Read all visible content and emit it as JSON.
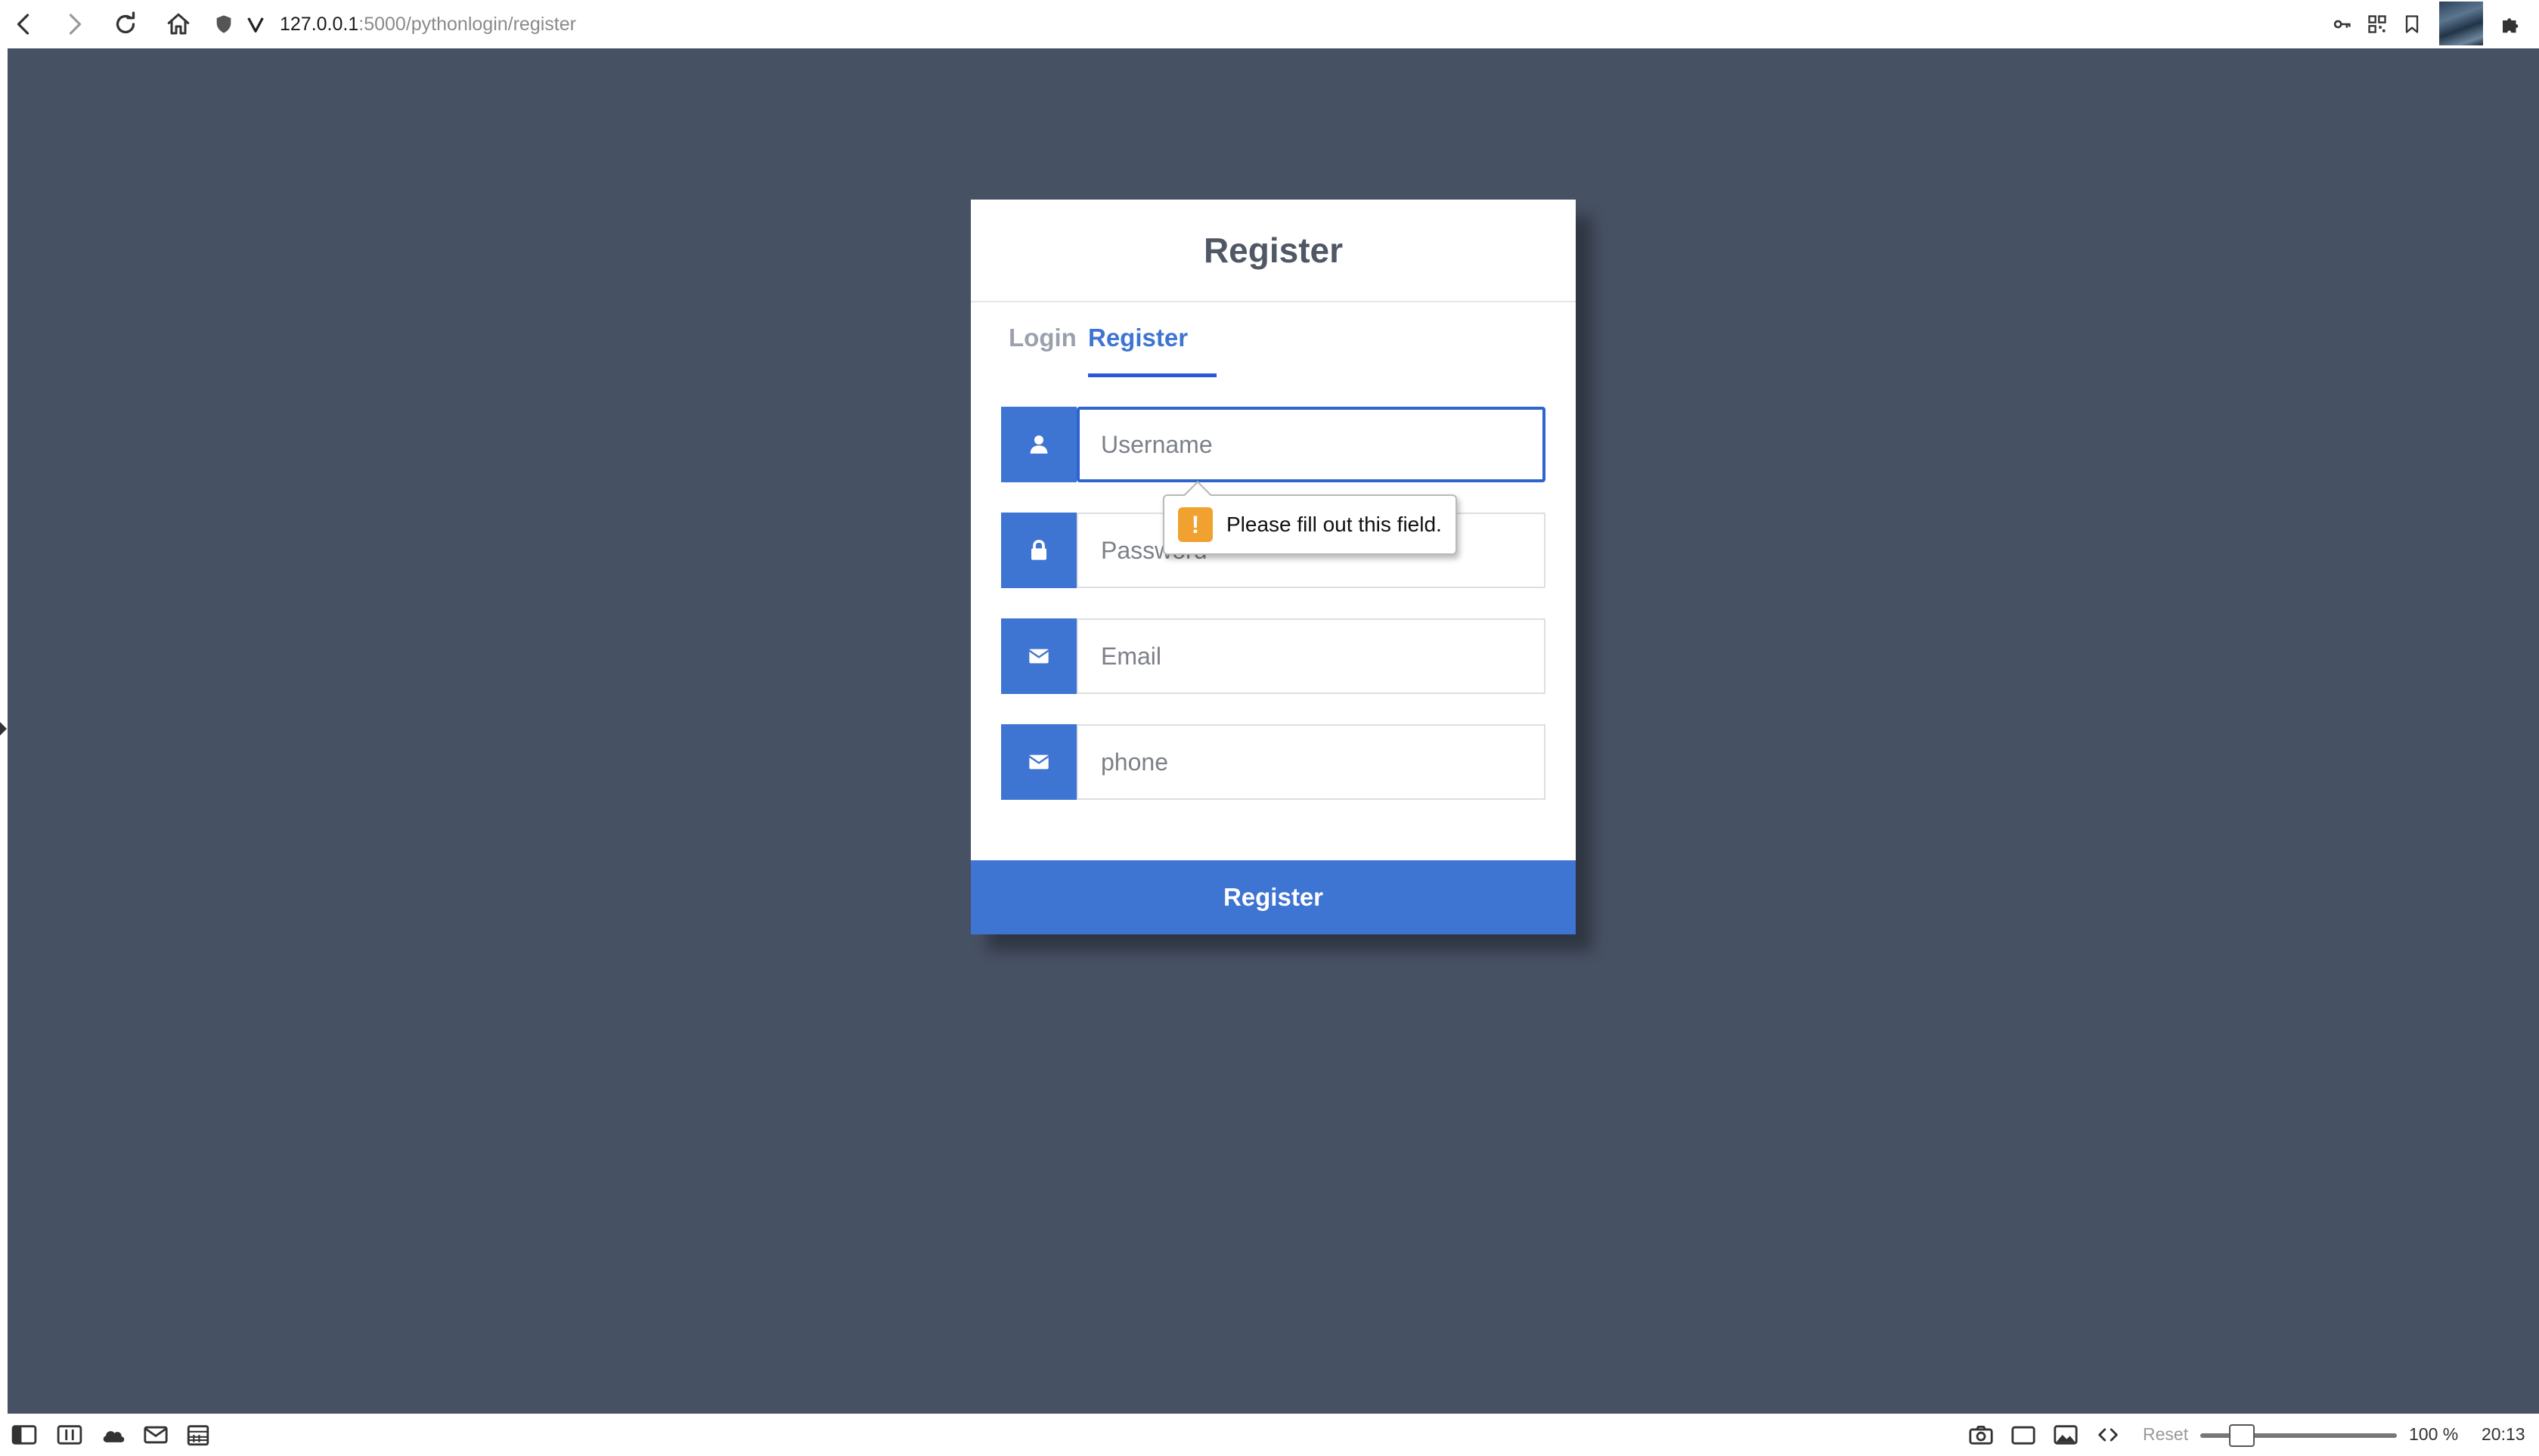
{
  "browser": {
    "url_host": "127.0.0.1",
    "url_rest": ":5000/pythonlogin/register"
  },
  "card": {
    "title": "Register",
    "tabs": [
      {
        "label": "Login",
        "active": false
      },
      {
        "label": "Register",
        "active": true
      }
    ],
    "fields": [
      {
        "name": "username",
        "placeholder": "Username",
        "icon": "user-icon",
        "focused": true
      },
      {
        "name": "password",
        "placeholder": "Password",
        "icon": "lock-icon",
        "focused": false
      },
      {
        "name": "email",
        "placeholder": "Email",
        "icon": "envelope-icon",
        "focused": false
      },
      {
        "name": "phone",
        "placeholder": "phone",
        "icon": "envelope-icon",
        "focused": false
      }
    ],
    "submit_label": "Register"
  },
  "tooltip": {
    "icon": "!",
    "message": "Please fill out this field."
  },
  "statusbar": {
    "reset_label": "Reset",
    "zoom_label": "100 %",
    "zoom_level": 1.0,
    "clock": "20:13"
  },
  "colors": {
    "page_background": "#475164",
    "accent": "#3e74d2",
    "warning": "#f0a130"
  }
}
